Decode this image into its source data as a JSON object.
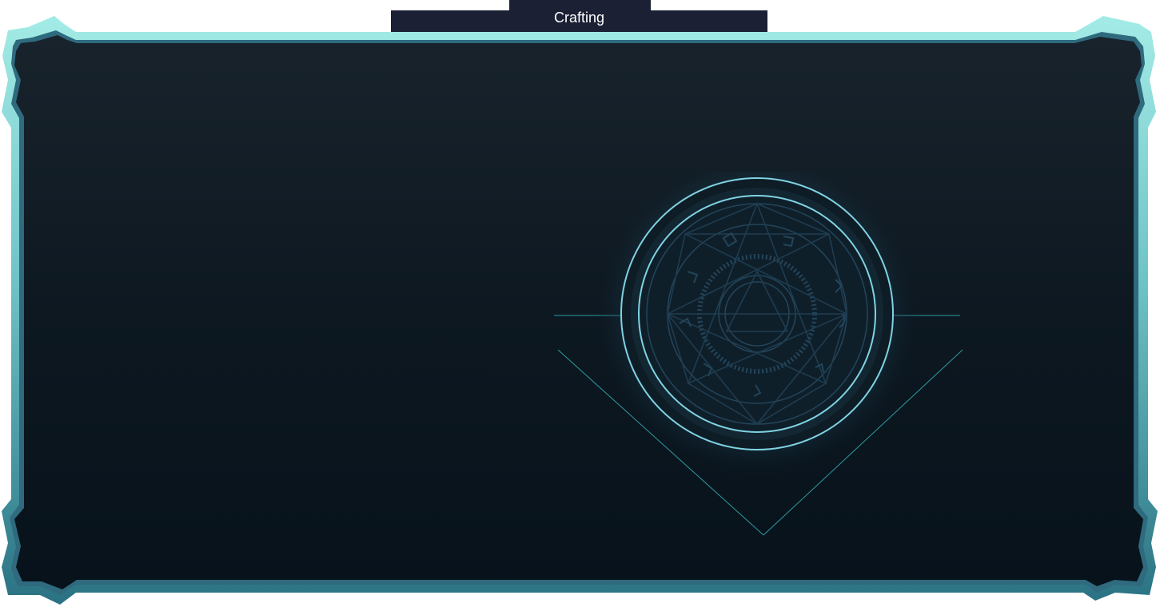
{
  "window": {
    "title": "Crafting"
  },
  "colors": {
    "frame_light": "#9fe6e2",
    "frame_dark": "#2a7283",
    "panel_top": "#18222b",
    "panel_bottom": "#07121b",
    "title_bg": "#1c2035",
    "circle_stroke": "#7fd3e3",
    "line_stroke": "#2f9aa0",
    "rune_color": "#23455a"
  },
  "icons": {
    "crafting_circle": "transmutation-circle-icon"
  }
}
